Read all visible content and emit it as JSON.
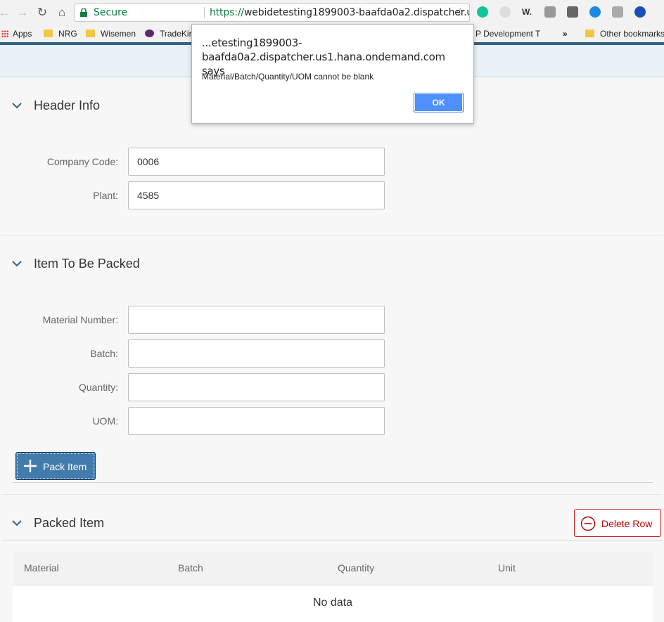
{
  "browser": {
    "secure_label": "Secure",
    "url_scheme": "https://",
    "url_host": "webidetesting1899003-baafda0a2.dispatcher.us1.hana.ondema...",
    "extensions": [
      "grammarly-icon",
      "grey-extension-icon",
      "w-extension-icon",
      "save-extension-icon",
      "extension-icon",
      "edge-icon",
      "g-extension-icon",
      "a-extension-icon"
    ],
    "colors": {
      "secure_green": "#0b8043",
      "shell_blue": "#346187"
    }
  },
  "bookmarks": {
    "apps": "Apps",
    "items": [
      "NRG",
      "Wisemen",
      "TradeKir",
      "P Development T"
    ],
    "more": "»",
    "other": "Other bookmarks"
  },
  "header_section": {
    "title": "Header Info",
    "company_code_label": "Company Code:",
    "company_code_value": "0006",
    "plant_label": "Plant:",
    "plant_value": "4585"
  },
  "item_section": {
    "title": "Item To Be Packed",
    "material_label": "Material Number:",
    "batch_label": "Batch:",
    "quantity_label": "Quantity:",
    "uom_label": "UOM:",
    "material_value": "",
    "batch_value": "",
    "quantity_value": "",
    "uom_value": "",
    "pack_button": "Pack Item"
  },
  "packed_section": {
    "title": "Packed Item",
    "delete_button": "Delete Row",
    "columns": [
      "Material",
      "Batch",
      "Quantity",
      "Unit"
    ],
    "no_data": "No data"
  },
  "dialog": {
    "title": "...etesting1899003-baafda0a2.dispatcher.us1.hana.ondemand.com says",
    "message": "Material/Batch/Quantity/UOM cannot be blank",
    "ok": "OK"
  }
}
